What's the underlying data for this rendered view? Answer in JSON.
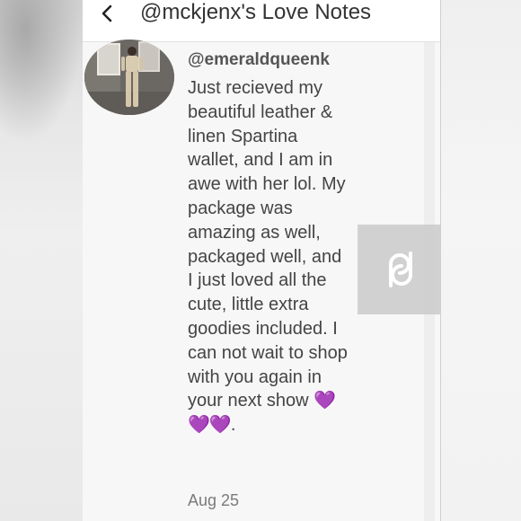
{
  "header": {
    "title": "@mckjenx's Love Notes",
    "back_icon": "chevron-left-icon"
  },
  "note": {
    "username": "@emeraldqueenk",
    "body": "Just recieved my beautiful leather & linen Spartina wallet, and I am in awe with her lol. My package was amazing as well, packaged well, and I just loved all the cute, little extra goodies included. I can not wait to shop with you again in your next show ",
    "hearts": "💜💜💜",
    "end_punct": ".",
    "date": "Aug 25",
    "avatar": "user-avatar-photo"
  },
  "overlay": {
    "icon": "poshmark-link-icon"
  },
  "colors": {
    "heart": "#a43bd8",
    "text": "#444444",
    "date": "#7a7a7a"
  }
}
